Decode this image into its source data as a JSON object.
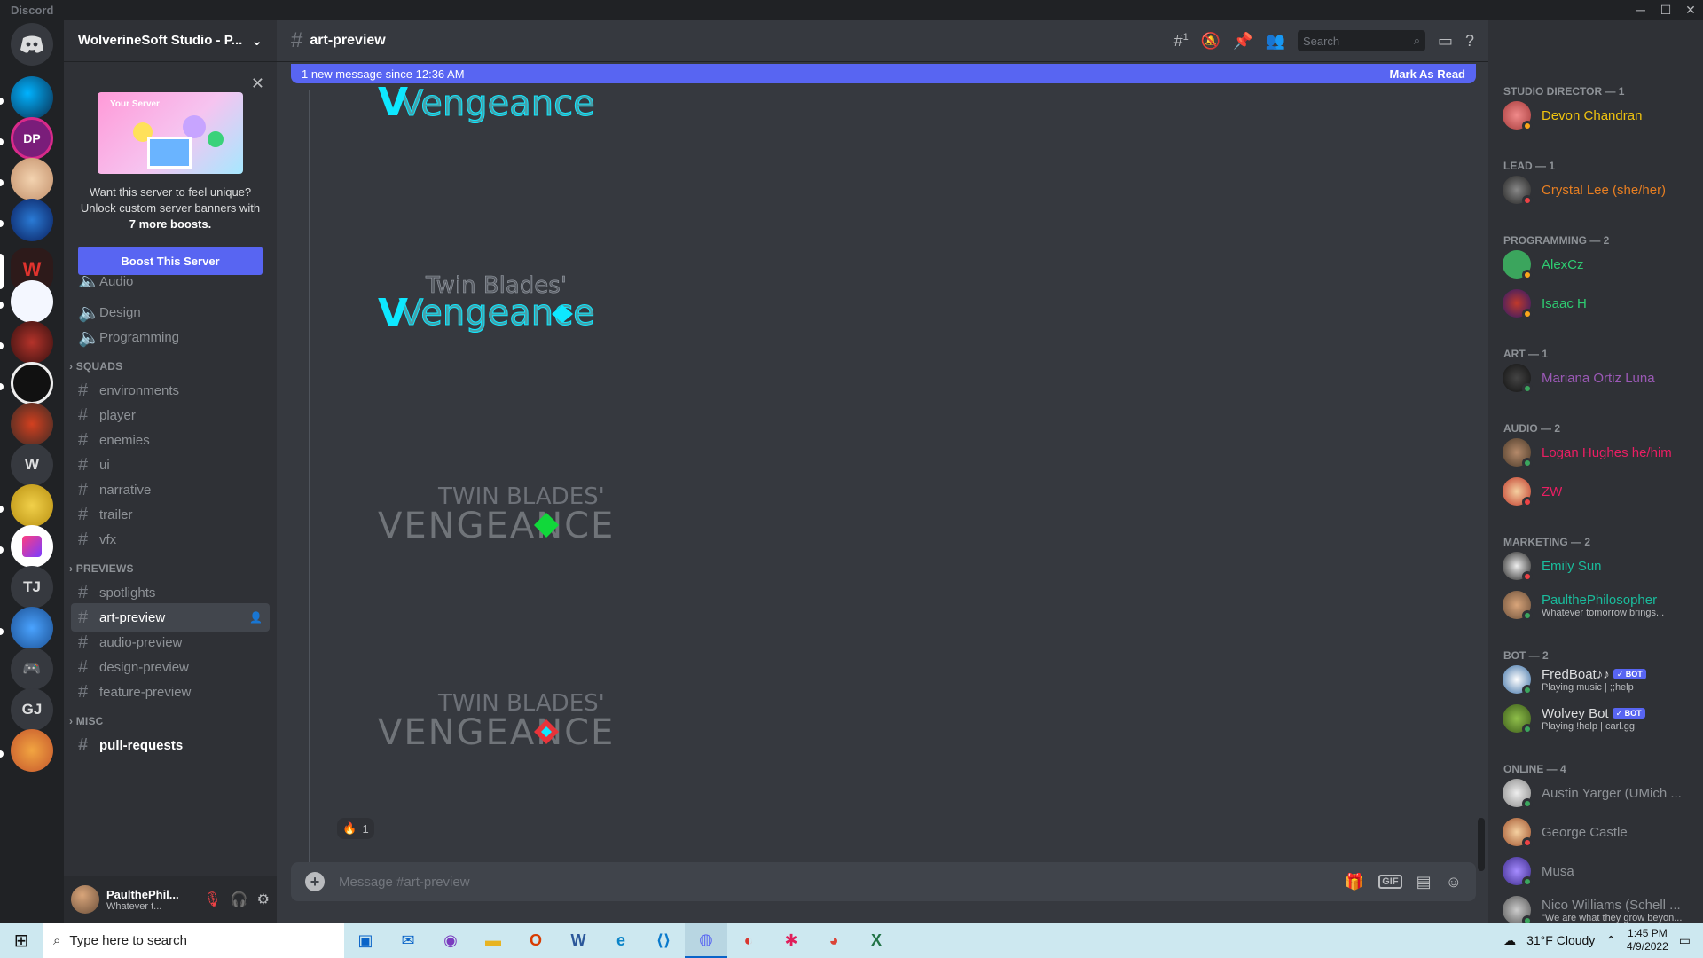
{
  "window": {
    "app_name": "Discord",
    "minimize": "─",
    "maximize": "☐",
    "close": "✕"
  },
  "server": {
    "name": "WolverineSoft Studio - P...",
    "chevron": "⌄",
    "guild_letters": [
      "W",
      "TJ",
      "GJ"
    ]
  },
  "boost_card": {
    "banner_title": "Your Server",
    "line1": "Want this server to feel unique?",
    "line2": "Unlock custom server banners with",
    "line3": "7 more boosts.",
    "button": "Boost This Server",
    "close": "✕"
  },
  "channels": {
    "voice": [
      "Audio",
      "Design",
      "Programming"
    ],
    "cat_squads": "SQUADS",
    "squads": [
      "environments",
      "player",
      "enemies",
      "ui",
      "narrative",
      "trailer",
      "vfx"
    ],
    "cat_previews": "PREVIEWS",
    "previews": [
      "spotlights",
      "art-preview",
      "audio-preview",
      "design-preview",
      "feature-preview"
    ],
    "cat_misc": "MISC",
    "misc": [
      "pull-requests"
    ]
  },
  "user": {
    "name": "PaulthePhil...",
    "status": "Whatever t..."
  },
  "chat": {
    "channel": "art-preview",
    "new_messages": "1 new message since 12:36 AM",
    "mark_read": "Mark As Read",
    "logo_top": "Twin Blades'",
    "logo_caps_top": "TWIN BLADES'",
    "logo_word": "Vengeance",
    "logo_caps_word": "VENGEANCE",
    "reaction_emoji": "🔥",
    "reaction_count": "1",
    "composer_placeholder": "Message #art-preview",
    "threads_count": "1",
    "search_placeholder": "Search",
    "gif": "GIF"
  },
  "members": {
    "roles": [
      {
        "title": "STUDIO DIRECTOR — 1"
      },
      {
        "title": "LEAD — 1"
      },
      {
        "title": "PROGRAMMING — 2"
      },
      {
        "title": "ART — 1"
      },
      {
        "title": "AUDIO — 2"
      },
      {
        "title": "MARKETING — 2"
      },
      {
        "title": "BOT — 2"
      },
      {
        "title": "ONLINE — 4"
      }
    ],
    "list": [
      {
        "name": "Devon Chandran",
        "color": "#f1c40f",
        "status": "#faa61a"
      },
      {
        "name": "Crystal Lee (she/her)",
        "color": "#e67e22",
        "status": "#ed4245"
      },
      {
        "name": "AlexCz",
        "color": "#2ecc71",
        "status": "#faa61a"
      },
      {
        "name": "Isaac H",
        "color": "#2ecc71",
        "status": "#faa61a"
      },
      {
        "name": "Mariana Ortiz Luna",
        "color": "#9b59b6",
        "status": "#3ba55d"
      },
      {
        "name": "Logan Hughes he/him",
        "color": "#e91e63",
        "status": "#3ba55d"
      },
      {
        "name": "ZW",
        "color": "#e91e63",
        "status": "#ed4245"
      },
      {
        "name": "Emily Sun",
        "color": "#1abc9c",
        "status": "#ed4245"
      },
      {
        "name": "PaulthePhilosopher",
        "color": "#1abc9c",
        "status": "#3ba55d",
        "sub": "Whatever tomorrow brings..."
      },
      {
        "name": "FredBoat♪♪",
        "color": "#dcddde",
        "status": "#3ba55d",
        "sub": "Playing music | ;;help",
        "bot": "✓ BOT"
      },
      {
        "name": "Wolvey Bot",
        "color": "#dcddde",
        "status": "#3ba55d",
        "sub": "Playing !help | carl.gg",
        "bot": "✓ BOT"
      },
      {
        "name": "Austin Yarger (UMich ...",
        "color": "#8e9297",
        "status": "#3ba55d"
      },
      {
        "name": "George Castle",
        "color": "#8e9297",
        "status": "#ed4245"
      },
      {
        "name": "Musa",
        "color": "#8e9297",
        "status": "#3ba55d"
      },
      {
        "name": "Nico Williams (Schell ...",
        "color": "#8e9297",
        "status": "#3ba55d",
        "sub": "\"We are what they grow beyon..."
      }
    ]
  },
  "taskbar": {
    "search": "Type here to search",
    "weather": "31°F  Cloudy",
    "time": "1:45 PM",
    "date": "4/9/2022"
  }
}
